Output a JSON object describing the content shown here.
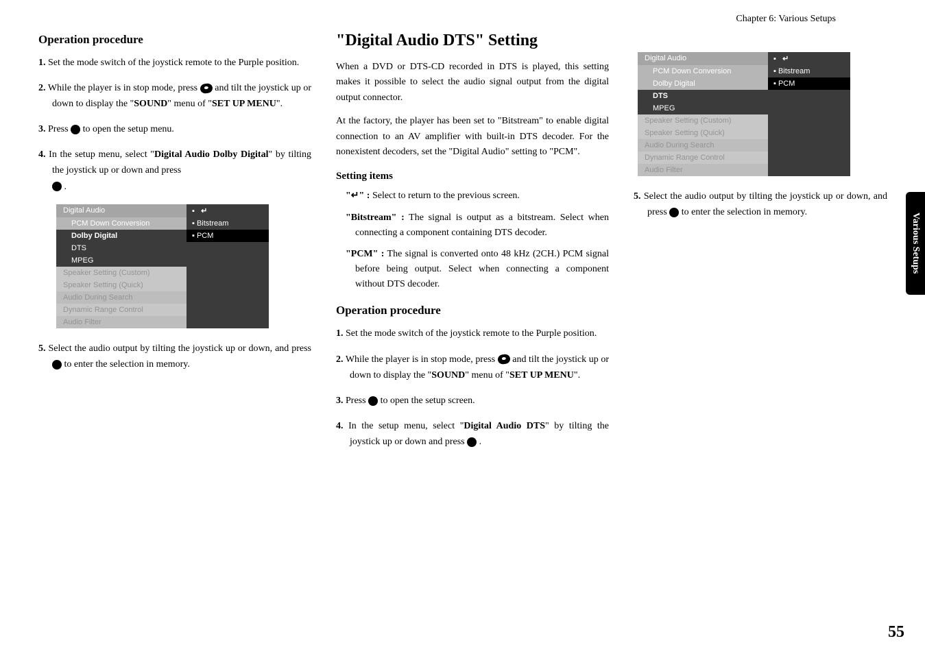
{
  "chapter": "Chapter 6: Various Setups",
  "side_tab": "Various Setups",
  "page_num": "55",
  "col1": {
    "h_op": "Operation procedure",
    "s1_a": "1.",
    "s1_b": "Set the mode switch of the joystick remote to the Purple position.",
    "s2_a": "2.",
    "s2_b": "While the player is in stop mode, press ",
    "s2_c": " and tilt the joystick up or down to display the \"",
    "s2_d": "SOUND",
    "s2_e": "\" menu of \"",
    "s2_f": "SET UP MENU",
    "s2_g": "\".",
    "s3_a": "3.",
    "s3_b": "Press ",
    "s3_c": " to open the setup menu.",
    "s4_a": "4.",
    "s4_b": "In the setup menu, select \"",
    "s4_c": "Digital Audio Dolby Digital",
    "s4_d": "\" by tilting the joystick up or down and press ",
    "s4_e": " .",
    "s5_a": "5.",
    "s5_b": "Select the audio output by tilting the joystick up or down, and press ",
    "s5_c": " to enter the selection in memory."
  },
  "menu1": {
    "digital_audio": "Digital Audio",
    "pcm_down": "PCM Down Conversion",
    "dolby": "Dolby Digital",
    "dts": "DTS",
    "mpeg": "MPEG",
    "spk_custom": "Speaker Setting (Custom)",
    "spk_quick": "Speaker Setting (Quick)",
    "audio_search": "Audio  During Search",
    "drc": "Dynamic Range Control",
    "filter": "Audio  Filter",
    "opt_bitstream": "Bitstream",
    "opt_pcm": "PCM"
  },
  "col2": {
    "h_section": "\"Digital Audio DTS\" Setting",
    "p1": "When a DVD or DTS-CD recorded in DTS is played, this setting makes it possible to select the audio signal output from the digital output connector.",
    "p2_a": "At the factory, the player has been set to \"",
    "p2_b": "Bitstream",
    "p2_c": "\" to enable digital connection to an AV amplifier with built-in DTS decoder. For the nonexistent decoders, set the \"",
    "p2_d": "Digital Audio",
    "p2_e": "\" setting to \"",
    "p2_f": "PCM",
    "p2_g": "\".",
    "h_items": "Setting items",
    "it1_a": "\"",
    "it1_ret": "↵",
    "it1_b": "\" :",
    "it1_c": " Select to return to the previous screen.",
    "it2_a": "\"Bitstream\" :",
    "it2_b": " The signal is output as a bitstream. Select when connecting a component containing DTS decoder.",
    "it3_a": "\"PCM\" :",
    "it3_b": "  The signal is converted onto 48 kHz (2CH.) PCM signal before being output. Select when connecting a component without DTS decoder.",
    "h_op": "Operation procedure",
    "s1_a": "1.",
    "s1_b": "Set the mode switch of the joystick remote to the Purple position.",
    "s2_a": "2.",
    "s2_b": "While the player is in stop mode, press ",
    "s2_c": " and tilt the joystick up or down to display the \"",
    "s2_d": "SOUND",
    "s2_e": "\" menu of \"",
    "s2_f": "SET UP MENU",
    "s2_g": "\".",
    "s3_a": "3.",
    "s3_b": "Press ",
    "s3_c": " to open the setup screen.",
    "s4_a": "4.",
    "s4_b": "In the setup menu, select \"",
    "s4_c": "Digital Audio DTS",
    "s4_d": "\" by tilting the joystick up or down and press ",
    "s4_e": " ."
  },
  "col3": {
    "s5_a": "5.",
    "s5_b": "Select the audio output by tilting the joystick up or down, and press ",
    "s5_c": " to enter the selection in memory."
  }
}
